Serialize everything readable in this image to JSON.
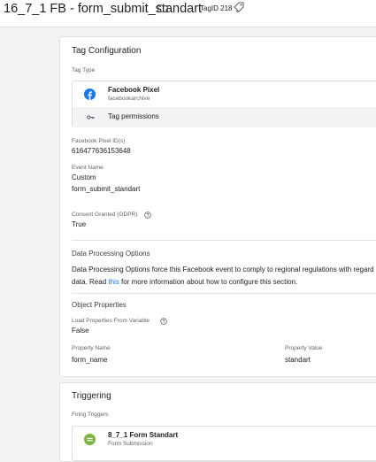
{
  "header": {
    "title": "16_7_1 FB - form_submit_standart",
    "tag_id_label": "TagID 218"
  },
  "tag_config": {
    "title": "Tag Configuration",
    "tag_type_label": "Tag Type",
    "tag_type_name": "Facebook Pixel",
    "tag_type_source": "facebookarchive",
    "permissions_label": "Tag permissions",
    "pixel_ids_label": "Facebook Pixel ID(s)",
    "pixel_ids_value": "616477636153648",
    "event_name_label": "Event Name",
    "event_name_type": "Custom",
    "event_name_value": "form_submit_standart",
    "consent_label": "Consent Granted (GDPR)",
    "consent_value": "True",
    "dpo_title": "Data Processing Options",
    "dpo_text_1": "Data Processing Options force this Facebook event to comply to regional regulations with regard",
    "dpo_text_2a": "data. Read ",
    "dpo_link": "this",
    "dpo_text_2b": " for more information about how to configure this section.",
    "object_props_title": "Object Properties",
    "load_props_label": "Load Properties From Variable",
    "load_props_value": "False",
    "prop_name_header": "Property Name",
    "prop_value_header": "Property Value",
    "prop_name": "form_name",
    "prop_value": "standart"
  },
  "triggering": {
    "title": "Triggering",
    "firing_label": "Firing Triggers",
    "trigger_name": "8_7_1 Form Standart",
    "trigger_type": "Form Submission"
  },
  "icons": {
    "folder": "folder-icon",
    "tag": "tag-icon",
    "facebook": "facebook-icon",
    "key": "key-icon",
    "help": "help-icon",
    "trigger": "form-submission-icon"
  },
  "colors": {
    "facebook": "#1877f2",
    "trigger": "#7cb342",
    "link": "#1a73e8"
  }
}
